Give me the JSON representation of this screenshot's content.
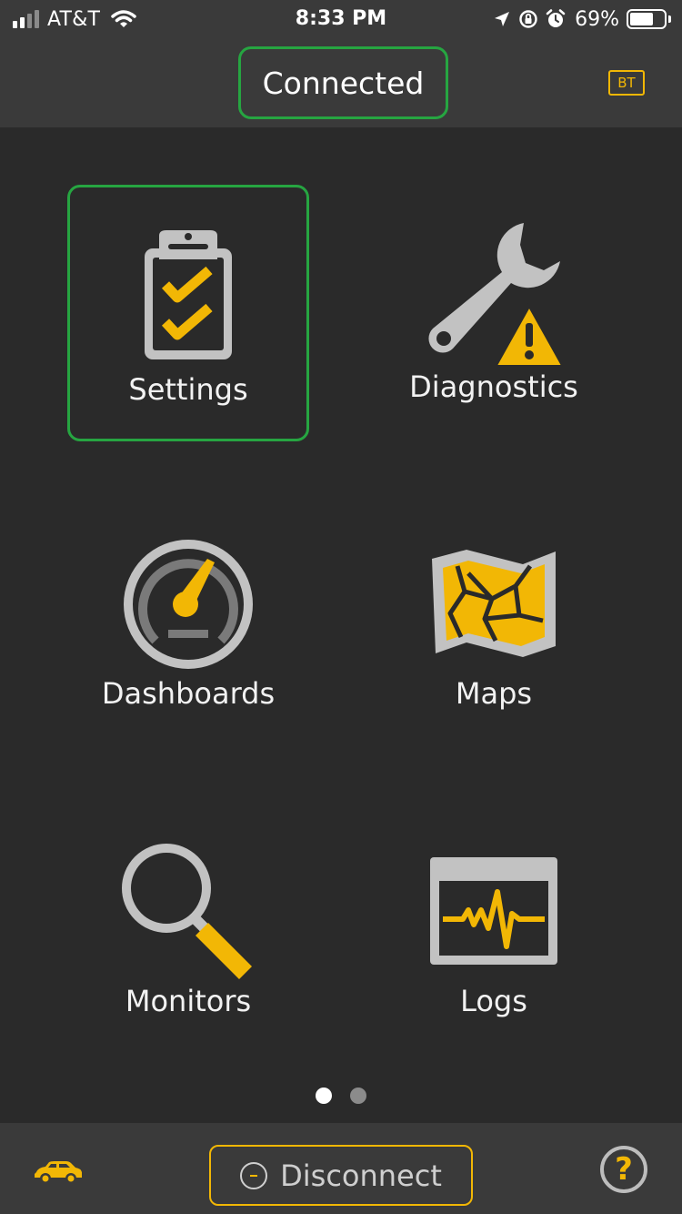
{
  "status_bar": {
    "carrier": "AT&T",
    "time": "8:33 PM",
    "battery_percent": "69%",
    "battery_level": 0.69,
    "icons": [
      "signal-icon",
      "wifi-icon",
      "location-icon",
      "orientation-lock-icon",
      "alarm-icon",
      "battery-icon"
    ]
  },
  "header": {
    "connection_status": "Connected",
    "bt_label": "BT"
  },
  "menu": {
    "items": [
      {
        "label": "Settings",
        "icon": "clipboard-checklist-icon",
        "selected": true
      },
      {
        "label": "Diagnostics",
        "icon": "wrench-warning-icon",
        "selected": false
      },
      {
        "label": "Dashboards",
        "icon": "gauge-icon",
        "selected": false
      },
      {
        "label": "Maps",
        "icon": "map-icon",
        "selected": false
      },
      {
        "label": "Monitors",
        "icon": "magnifier-icon",
        "selected": false
      },
      {
        "label": "Logs",
        "icon": "waveform-log-icon",
        "selected": false
      }
    ]
  },
  "pagination": {
    "pages": 2,
    "current": 1
  },
  "bottom_bar": {
    "disconnect_label": "Disconnect",
    "help_symbol": "?",
    "icons": [
      "car-icon",
      "minus-circle-icon",
      "help-icon"
    ]
  },
  "colors": {
    "background": "#2a2a2a",
    "bar": "#3a3a3a",
    "accent_yellow": "#f2b705",
    "icon_gray": "#c2c2c2",
    "selected_green": "#26a541"
  }
}
